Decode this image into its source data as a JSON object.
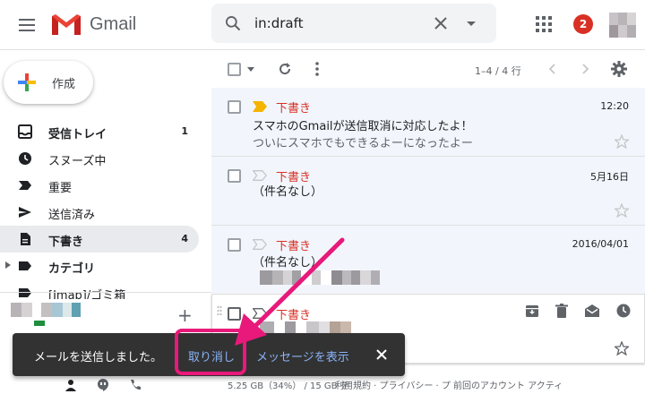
{
  "header": {
    "app_name": "Gmail",
    "search_value": "in:draft",
    "notification_count": "2"
  },
  "sidebar": {
    "compose_label": "作成",
    "items": [
      {
        "label": "受信トレイ",
        "count": "1",
        "icon": "inbox-icon"
      },
      {
        "label": "スヌーズ中",
        "count": "",
        "icon": "clock-icon"
      },
      {
        "label": "重要",
        "count": "",
        "icon": "important-icon"
      },
      {
        "label": "送信済み",
        "count": "",
        "icon": "send-icon"
      },
      {
        "label": "下書き",
        "count": "4",
        "icon": "draft-icon"
      },
      {
        "label": "カテゴリ",
        "count": "",
        "icon": "label-icon"
      },
      {
        "label": "[Imap]/ゴミ箱",
        "count": "",
        "icon": "label-icon"
      }
    ]
  },
  "toolbar": {
    "pager": "1–4 / 4 行"
  },
  "emails": [
    {
      "sender": "下書き",
      "date": "12:20",
      "subject": "スマホのGmailが送信取消に対応したよ！",
      "snippet": "ついにスマホでもできるよーになったよー",
      "important": true
    },
    {
      "sender": "下書き",
      "date": "5月16日",
      "subject": "（件名なし）",
      "snippet": "",
      "important": false
    },
    {
      "sender": "下書き",
      "date": "2016/04/01",
      "subject": "（件名なし）",
      "snippet": "",
      "important": false
    },
    {
      "sender": "下書き",
      "date": "",
      "subject": "",
      "snippet": "",
      "important": false
    }
  ],
  "footer": {
    "storage": "5.25 GB（34%） / 15 GB を",
    "links": "利用規約 · プライバシー · プ   前回のアカウント アクティ"
  },
  "snackbar": {
    "message": "メールを送信しました。",
    "undo_label": "取り消し",
    "view_label": "メッセージを表示"
  },
  "colors": {
    "accent_red": "#d93025",
    "highlight_pink": "#e8197a",
    "link_blue": "#8ab4f8",
    "important_yellow": "#f4b400"
  }
}
